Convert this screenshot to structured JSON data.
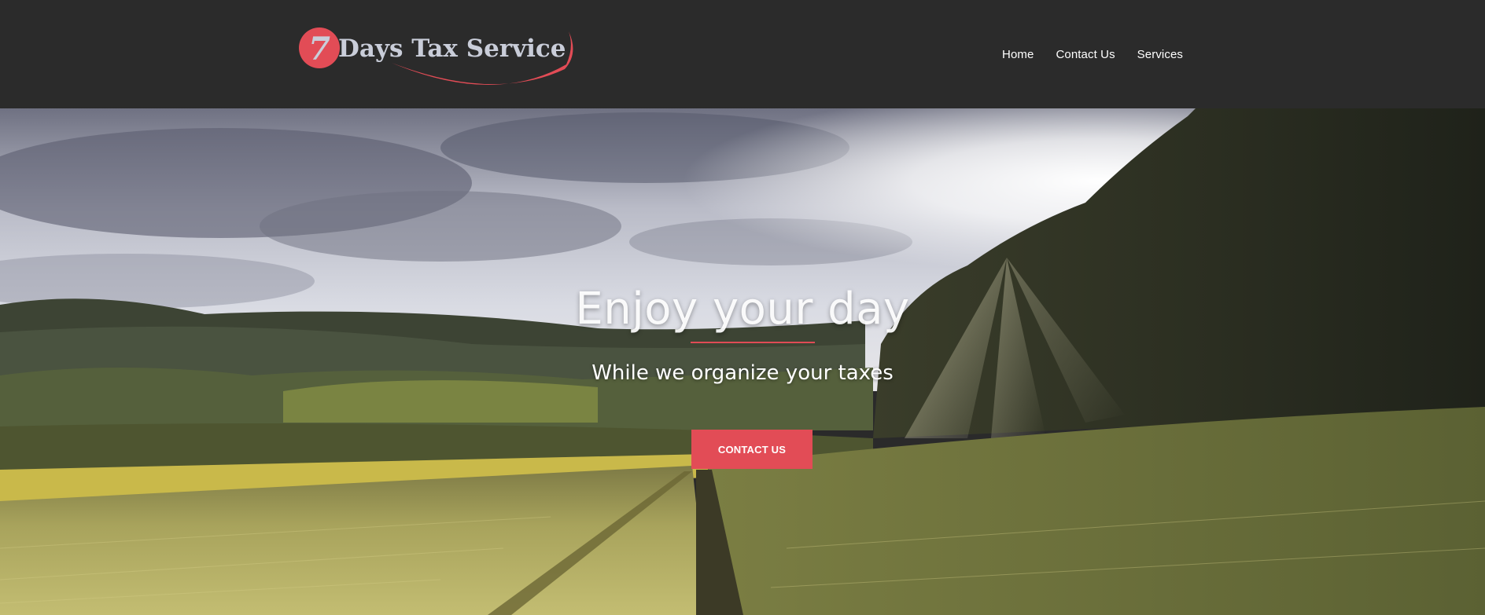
{
  "brand": {
    "logo_number": "7",
    "logo_text": "Days Tax Service",
    "accent_color": "#e24c56",
    "text_color": "#c9cdd9"
  },
  "nav": {
    "items": [
      {
        "label": "Home"
      },
      {
        "label": "Contact Us"
      },
      {
        "label": "Services"
      }
    ]
  },
  "hero": {
    "title": "Enjoy your day",
    "subtitle": "While we organize your taxes",
    "cta_label": "CONTACT US",
    "background": "landscape-photo-wheat-field-sunrise"
  },
  "colors": {
    "header_bg": "#2b2b2b",
    "button_bg": "#e24c56",
    "divider": "#e04b55"
  }
}
